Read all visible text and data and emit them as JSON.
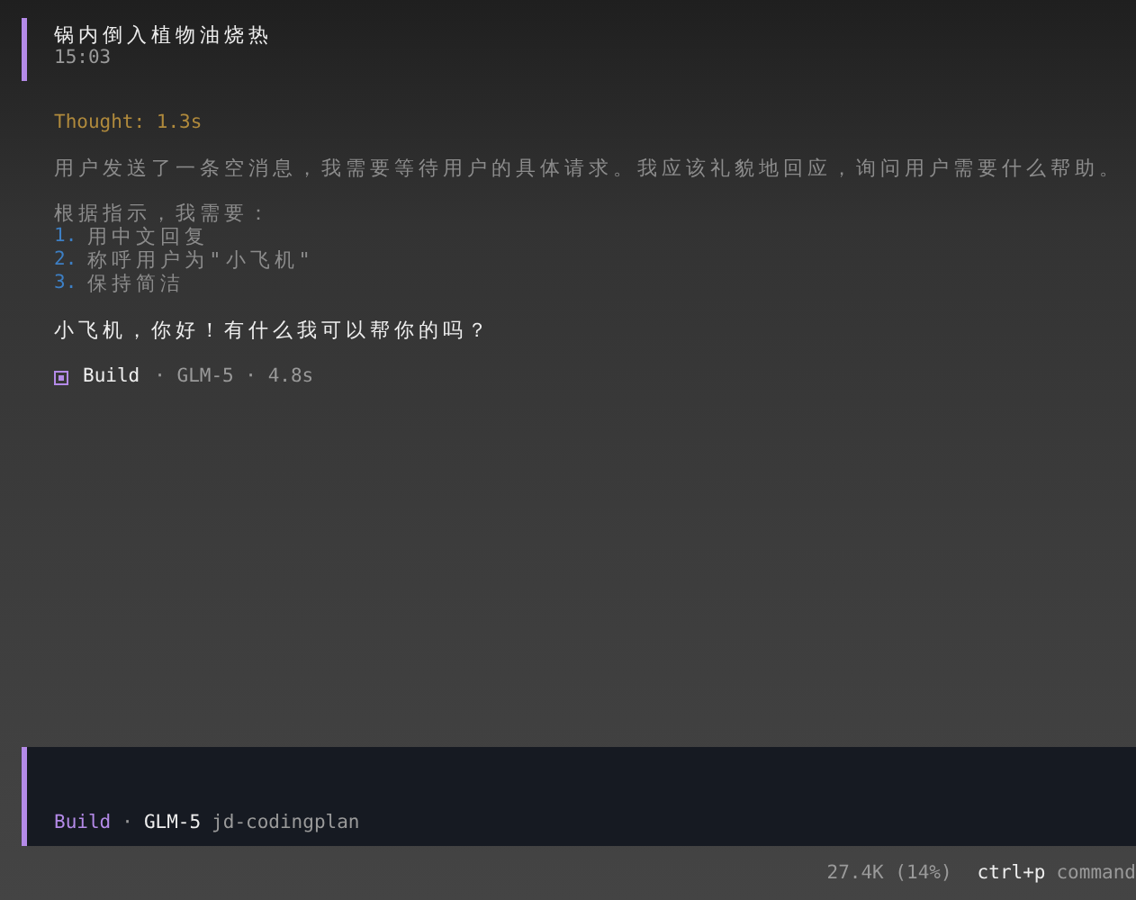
{
  "user_message": {
    "text": "锅内倒入植物油烧热",
    "time": "15:03"
  },
  "thought": {
    "label": "Thought: 1.3s",
    "summary": "用户发送了一条空消息，我需要等待用户的具体请求。我应该礼貌地回应，询问用户需要什么帮助。",
    "intro": "根据指示，我需要：",
    "steps": [
      {
        "number": "1.",
        "text": "用中文回复"
      },
      {
        "number": "2.",
        "text": "称呼用户为\"小飞机\""
      },
      {
        "number": "3.",
        "text": "保持简洁"
      }
    ]
  },
  "reply": "小飞机，你好！有什么我可以帮你的吗？",
  "meta": {
    "agent": "Build",
    "details": "· GLM-5 · 4.8s"
  },
  "prompt": {
    "agent": "Build",
    "separator": "·",
    "model": "GLM-5",
    "provider": "jd-codingplan"
  },
  "status_bar": {
    "usage": "27.4K (14%)",
    "shortcut_key": "ctrl+p",
    "shortcut_label": "command"
  }
}
